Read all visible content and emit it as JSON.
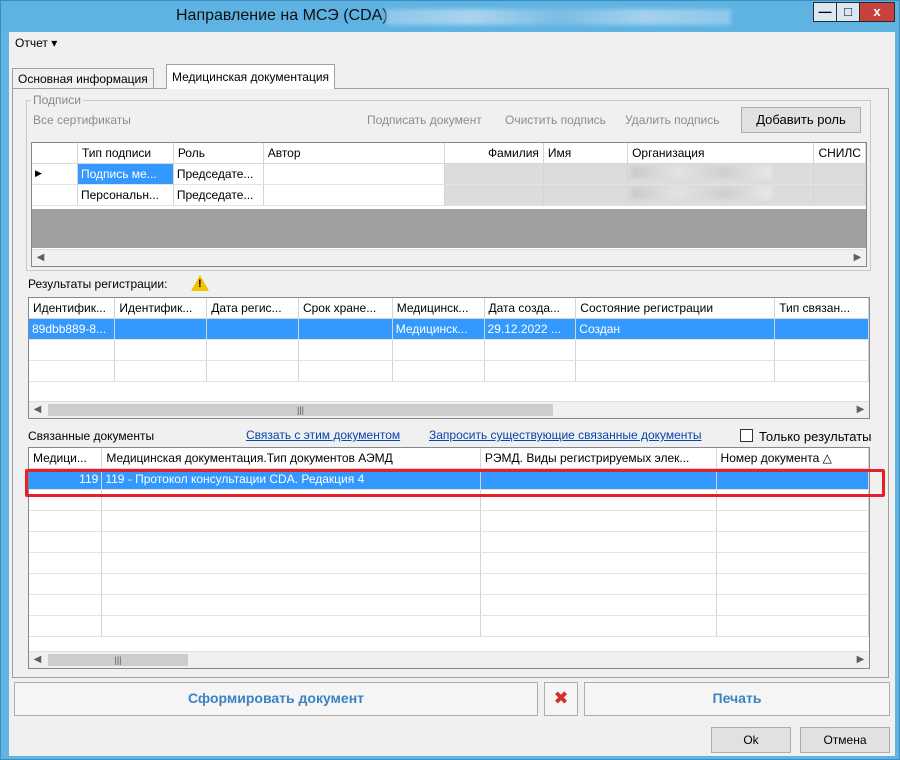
{
  "window": {
    "title": "Направление на МСЭ (CDA) -",
    "controls": {
      "minimize": "—",
      "maximize": "□",
      "close": "x"
    }
  },
  "menu": {
    "report": "Отчет ▾"
  },
  "tabs": [
    {
      "label": "Основная информация"
    },
    {
      "label": "Медицинская документация"
    }
  ],
  "signatures": {
    "legend": "Подписи",
    "all_certs": "Все сертификаты",
    "sign_document": "Подписать документ",
    "clear_signature": "Очистить подпись",
    "delete_signature": "Удалить подпись",
    "add_role": "Добавить роль",
    "columns": [
      "Тип подписи",
      "Роль",
      "Автор",
      "Фамилия",
      "Имя",
      "Организация",
      "СНИЛС"
    ],
    "rows": [
      {
        "marker": "▶",
        "type": "Подпись ме...",
        "role": "Председате...",
        "author": "",
        "last": "",
        "first": "",
        "snils": ""
      },
      {
        "marker": "",
        "type": "Персональн...",
        "role": "Председате...",
        "author": "",
        "last": "",
        "first": "",
        "snils": ""
      }
    ]
  },
  "registration": {
    "label": "Результаты регистрации:",
    "warning_icon": "warning-icon",
    "columns": [
      "Идентифик...",
      "Идентифик...",
      "Дата регис...",
      "Срок хране...",
      "Медицинск...",
      "Дата созда...",
      "Состояние регистрации",
      "Тип связан..."
    ],
    "rows": [
      [
        "89dbb889-8...",
        "",
        "",
        "",
        "Медицинск...",
        "29.12.2022 ...",
        "Создан",
        ""
      ]
    ]
  },
  "linked": {
    "label": "Связанные документы",
    "link_this": "Связать с этим документом",
    "request_existing": "Запросить существующие связанные документы",
    "only_results": "Только результаты",
    "only_results_checked": false,
    "columns": [
      "Медици...",
      "Медицинская документация.Тип документов АЭМД",
      "РЭМД. Виды регистрируемых элек...",
      "Номер документа △"
    ],
    "rows": [
      [
        "119",
        "119 - Протокол консультации CDA. Редакция 4",
        "",
        ""
      ]
    ]
  },
  "footer": {
    "generate": "Сформировать документ",
    "delete_icon": "pin-cross-icon",
    "print": "Печать",
    "ok": "Ok",
    "cancel": "Отмена"
  },
  "colors": {
    "accent": "#3399ff",
    "titlebar": "#5eb3e3",
    "highlight": "#e5202a",
    "link": "#0645ad"
  }
}
